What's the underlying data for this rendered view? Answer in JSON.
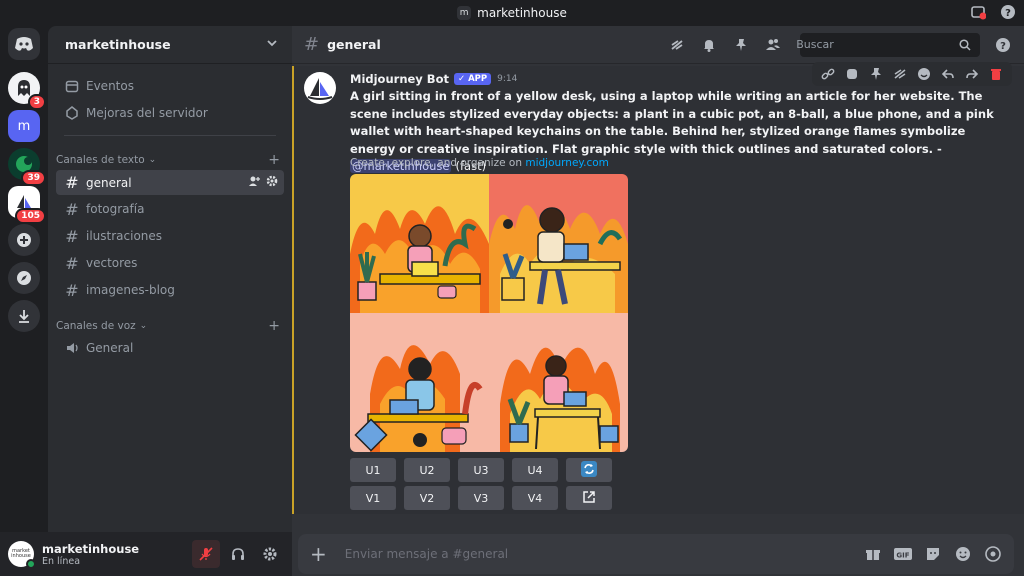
{
  "titlebar": {
    "server_initial": "m",
    "title": "marketinhouse"
  },
  "guilds": {
    "badges": [
      "3",
      "39",
      "105"
    ],
    "server_initial": "m"
  },
  "sidebar": {
    "server_name": "marketinhouse",
    "items": [
      {
        "label": "Eventos",
        "icon": "calendar-icon"
      },
      {
        "label": "Mejoras del servidor",
        "icon": "boost-icon"
      }
    ],
    "text_category": "Canales de texto",
    "text_channels": [
      "general",
      "fotografía",
      "ilustraciones",
      "vectores",
      "imagenes-blog"
    ],
    "voice_category": "Canales de voz",
    "voice_channels": [
      "General"
    ]
  },
  "user": {
    "name": "marketinhouse",
    "status": "En línea",
    "avatar_text": "market inhouse"
  },
  "header": {
    "channel": "general",
    "search_placeholder": "Buscar"
  },
  "message": {
    "author": "Midjourney Bot",
    "badge": "APP",
    "time": "9:14",
    "prompt": "A girl sitting in front of a yellow desk, using a laptop while writing an article for her website. The scene includes stylized everyday objects: a plant in a cubic pot, an 8-ball, a blue phone, and a pink wallet with heart-shaped keychains on the table. Behind her, stylized orange flames symbolize energy or creative inspiration. Flat graphic style with thick outlines and saturated colors. -",
    "mention": "@marketinhouse",
    "speed": "(fast)",
    "sub_text": "Create, explore, and organize on",
    "sub_link": "midjourney.com",
    "upscale_buttons": [
      "U1",
      "U2",
      "U3",
      "U4"
    ],
    "variation_buttons": [
      "V1",
      "V2",
      "V3",
      "V4"
    ]
  },
  "composer": {
    "placeholder": "Enviar mensaje a #general"
  },
  "colors": {
    "accent": "#5865f2",
    "highlight": "#c9a227",
    "badge": "#f23f43",
    "online": "#23a55a"
  }
}
